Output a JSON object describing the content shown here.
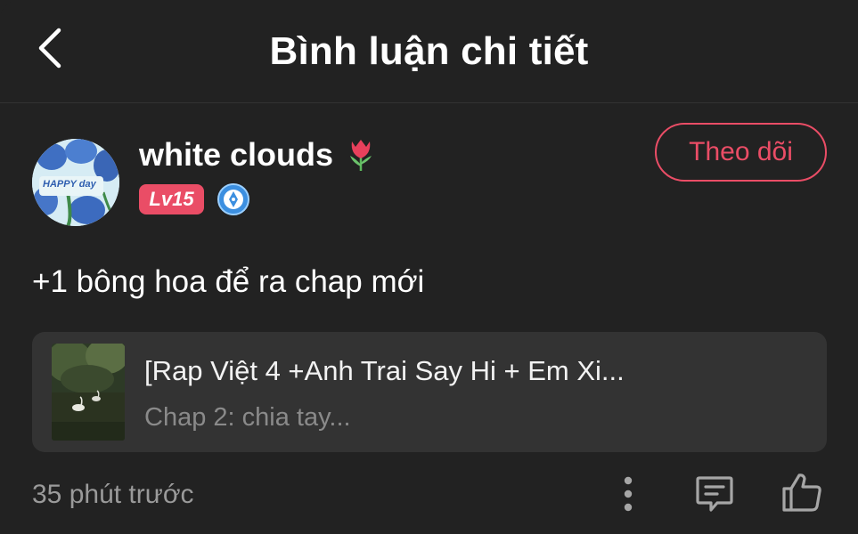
{
  "header": {
    "title": "Bình luận chi tiết",
    "back_icon": "chevron-left-icon"
  },
  "user": {
    "name": "white clouds",
    "emoji": "tulip-icon",
    "level": "Lv15",
    "badge_icon": "pen-nib-icon",
    "avatar_text": "HAPPY day",
    "follow_label": "Theo dõi"
  },
  "comment": {
    "text": "+1 bông hoa để ra chap mới"
  },
  "chapter": {
    "title": "[Rap Việt 4 +Anh Trai Say Hi + Em Xi...",
    "subtitle": "Chap 2: chia tay..."
  },
  "footer": {
    "time": "35 phút trước",
    "more_icon": "more-vertical-icon",
    "reply_icon": "comment-icon",
    "like_icon": "thumbs-up-icon"
  },
  "colors": {
    "background": "#222222",
    "accent": "#ea4d66",
    "card": "#333333",
    "muted_text": "#9a9a9a"
  }
}
